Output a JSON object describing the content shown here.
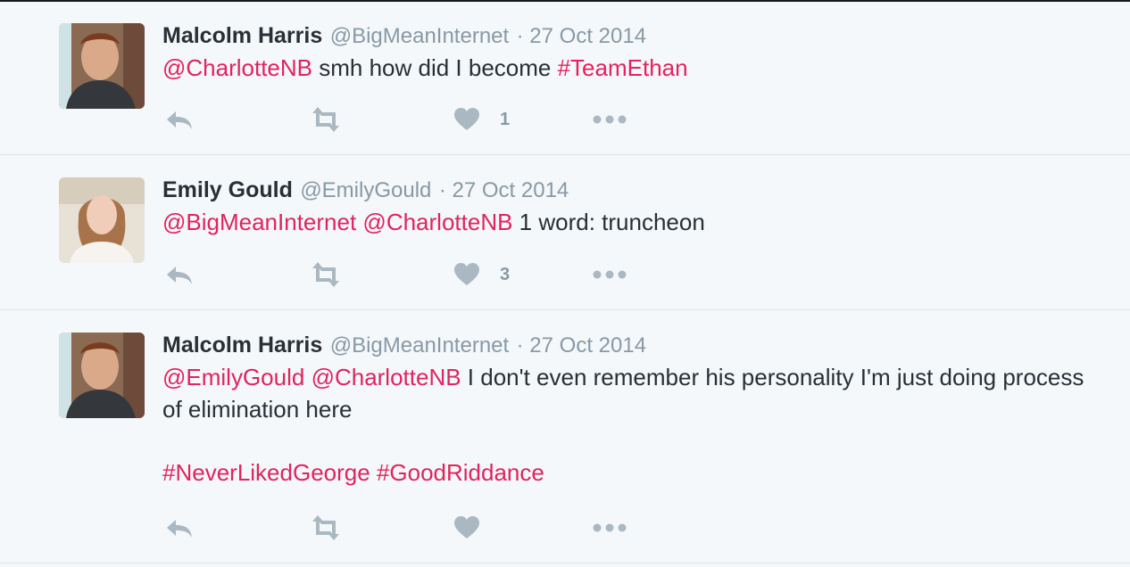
{
  "colors": {
    "background": "#f5f8fa",
    "link": "#e0245e",
    "meta": "#8899a6",
    "icon": "#aab8c2",
    "text": "#292f33",
    "divider": "#dfe4e8"
  },
  "tweets": [
    {
      "name": "Malcolm Harris",
      "handle": "@BigMeanInternet",
      "date": "· 27 Oct 2014",
      "line1": {
        "mention1": "@CharlotteNB",
        "text": " smh how did I become ",
        "hashtag": "#TeamEthan"
      },
      "likes": "1",
      "icons": [
        "reply-icon",
        "retweet-icon",
        "heart-icon",
        "more-icon"
      ]
    },
    {
      "name": "Emily Gould",
      "handle": "@EmilyGould",
      "date": "· 27 Oct 2014",
      "line1": {
        "mention1": "@BigMeanInternet",
        "mention2": "@CharlotteNB",
        "text": " 1 word: truncheon"
      },
      "likes": "3",
      "icons": [
        "reply-icon",
        "retweet-icon",
        "heart-icon",
        "more-icon"
      ]
    },
    {
      "name": "Malcolm Harris",
      "handle": "@BigMeanInternet",
      "date": "· 27 Oct 2014",
      "line1": {
        "mention1": "@EmilyGould",
        "mention2": "@CharlotteNB",
        "text": " I don't even remember his personality I'm just doing process of elimination here"
      },
      "line2": {
        "hashtag1": "#NeverLikedGeorge",
        "hashtag2": "#GoodRiddance"
      },
      "likes": "",
      "icons": [
        "reply-icon",
        "retweet-icon",
        "heart-icon",
        "more-icon"
      ]
    }
  ]
}
